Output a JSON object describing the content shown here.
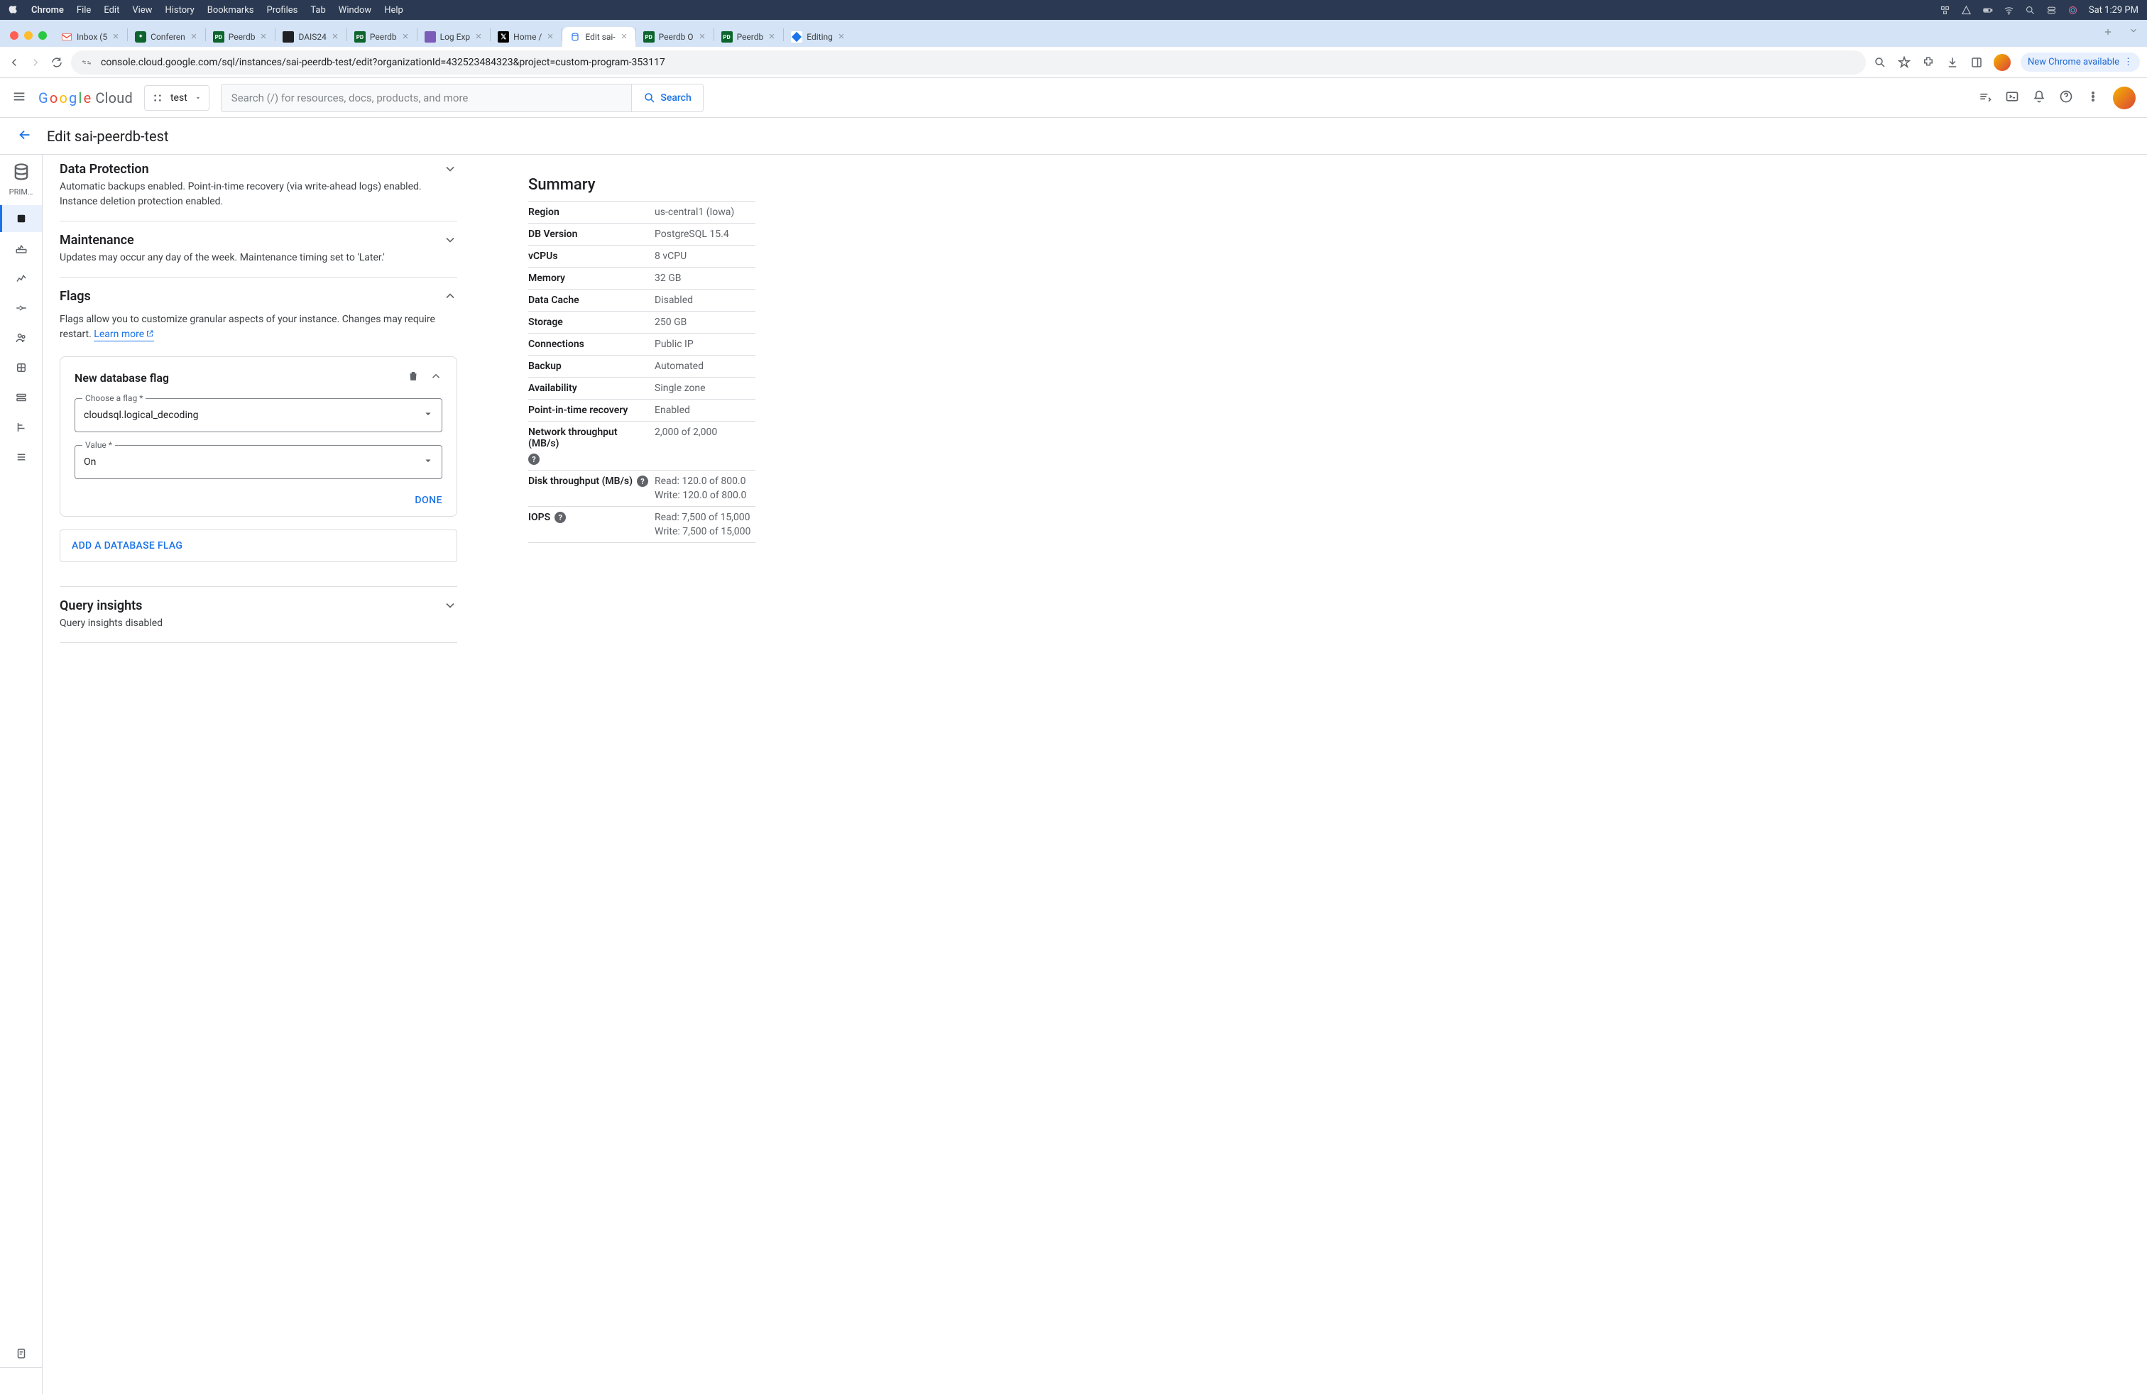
{
  "mac": {
    "app": "Chrome",
    "menus": [
      "File",
      "Edit",
      "View",
      "History",
      "Bookmarks",
      "Profiles",
      "Tab",
      "Window",
      "Help"
    ],
    "clock": "Sat 1:29 PM"
  },
  "tabs": [
    {
      "label": "Inbox (5",
      "fav": "gmail"
    },
    {
      "label": "Conferen",
      "fav": "green"
    },
    {
      "label": "Peerdb",
      "fav": "pd"
    },
    {
      "label": "DAIS24",
      "fav": "dark"
    },
    {
      "label": "Peerdb",
      "fav": "pd"
    },
    {
      "label": "Log Exp",
      "fav": "purple"
    },
    {
      "label": "Home /",
      "fav": "x"
    },
    {
      "label": "Edit sai-",
      "fav": "gcp",
      "active": true
    },
    {
      "label": "Peerdb O",
      "fav": "pd"
    },
    {
      "label": "Peerdb",
      "fav": "pd"
    },
    {
      "label": "Editing",
      "fav": "blue"
    }
  ],
  "omnibox": {
    "url": "console.cloud.google.com/sql/instances/sai-peerdb-test/edit?organizationId=432523484323&project=custom-program-353117",
    "update_label": "New Chrome available"
  },
  "gcp": {
    "logo_cloud": "Cloud",
    "project": "test",
    "search_placeholder": "Search (/) for resources, docs, products, and more",
    "search_btn": "Search",
    "page_title": "Edit sai-peerdb-test",
    "rail_label": "PRIM…"
  },
  "sections": {
    "data_protection": {
      "title": "Data Protection",
      "desc": "Automatic backups enabled. Point-in-time recovery (via write-ahead logs) enabled. Instance deletion protection enabled."
    },
    "maintenance": {
      "title": "Maintenance",
      "desc": "Updates may occur any day of the week. Maintenance timing set to 'Later.'"
    },
    "flags": {
      "title": "Flags",
      "desc": "Flags allow you to customize granular aspects of your instance. Changes may require restart. ",
      "learn_more": "Learn more",
      "card_title": "New database flag",
      "choose_flag_label": "Choose a flag *",
      "choose_flag_value": "cloudsql.logical_decoding",
      "value_label": "Value *",
      "value_value": "On",
      "done": "DONE",
      "add_btn": "ADD A DATABASE FLAG"
    },
    "query_insights": {
      "title": "Query insights",
      "desc": "Query insights disabled"
    }
  },
  "summary": {
    "title": "Summary",
    "rows": [
      {
        "k": "Region",
        "v": "us-central1 (Iowa)"
      },
      {
        "k": "DB Version",
        "v": "PostgreSQL 15.4"
      },
      {
        "k": "vCPUs",
        "v": "8 vCPU"
      },
      {
        "k": "Memory",
        "v": "32 GB"
      },
      {
        "k": "Data Cache",
        "v": "Disabled"
      },
      {
        "k": "Storage",
        "v": "250 GB"
      },
      {
        "k": "Connections",
        "v": "Public IP"
      },
      {
        "k": "Backup",
        "v": "Automated"
      },
      {
        "k": "Availability",
        "v": "Single zone"
      },
      {
        "k": "Point-in-time recovery",
        "v": "Enabled"
      },
      {
        "k": "Network throughput (MB/s)",
        "v": "2,000 of 2,000",
        "help": true
      },
      {
        "k": "Disk throughput (MB/s)",
        "v": "Read: 120.0 of 800.0",
        "v2": "Write: 120.0 of 800.0",
        "help": true
      },
      {
        "k": "IOPS",
        "v": "Read: 7,500 of 15,000",
        "v2": "Write: 7,500 of 15,000",
        "help": true
      }
    ]
  }
}
